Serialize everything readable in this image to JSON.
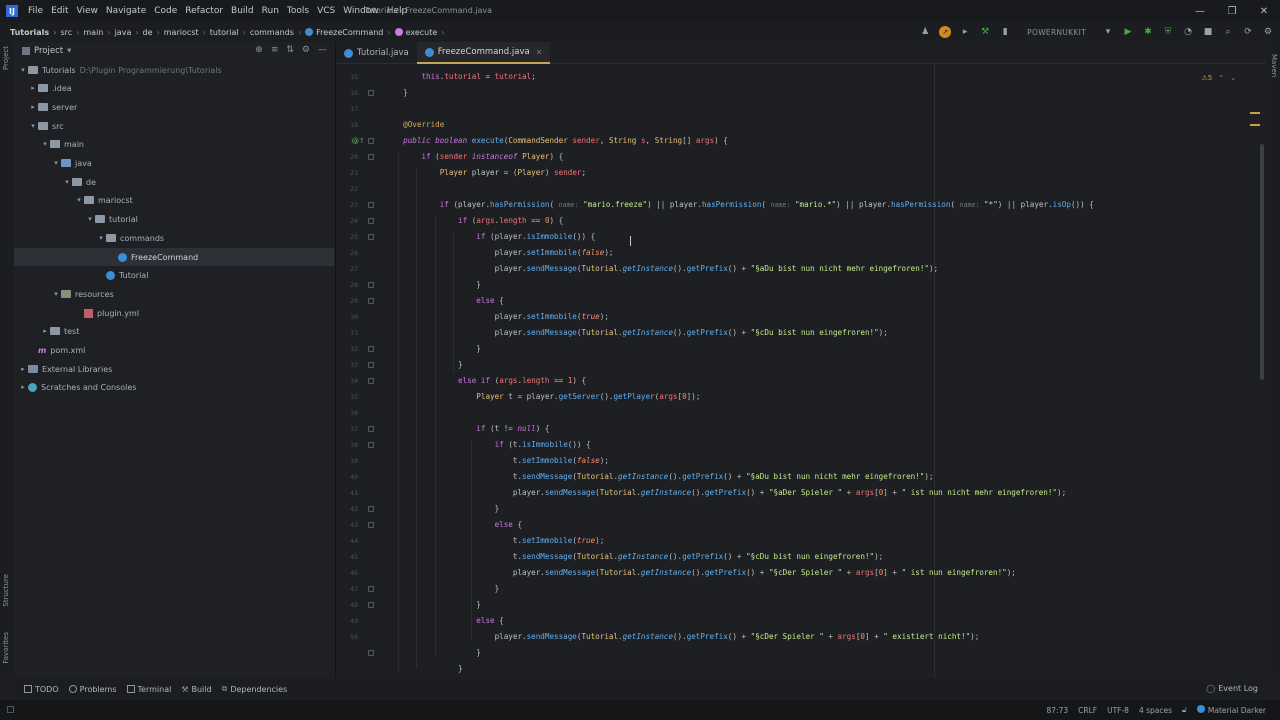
{
  "window": {
    "title": "Tutorials - FreezeCommand.java",
    "menu": [
      "File",
      "Edit",
      "View",
      "Navigate",
      "Code",
      "Refactor",
      "Build",
      "Run",
      "Tools",
      "VCS",
      "Window",
      "Help"
    ],
    "controls": {
      "minimize": "—",
      "maximize": "❐",
      "close": "✕"
    }
  },
  "breadcrumb": [
    "Tutorials",
    "src",
    "main",
    "java",
    "de",
    "mariocst",
    "tutorial",
    "commands",
    "FreezeCommand",
    "execute"
  ],
  "toolbar": {
    "run_config": "POWERNUKKIT"
  },
  "project_panel": {
    "title": "Project",
    "tree": [
      {
        "label": "Tutorials",
        "extra": "D:\\Plugin Programmierung\\Tutorials",
        "arrow": "▾",
        "icon": "folder"
      },
      {
        "label": ".idea",
        "arrow": "▸",
        "icon": "folder"
      },
      {
        "label": "server",
        "arrow": "▸",
        "icon": "folder"
      },
      {
        "label": "src",
        "arrow": "▾",
        "icon": "folder"
      },
      {
        "label": "main",
        "arrow": "▾",
        "icon": "folder"
      },
      {
        "label": "java",
        "arrow": "▾",
        "icon": "src"
      },
      {
        "label": "de",
        "arrow": "▾",
        "icon": "folder"
      },
      {
        "label": "mariocst",
        "arrow": "▾",
        "icon": "folder"
      },
      {
        "label": "tutorial",
        "arrow": "▾",
        "icon": "folder"
      },
      {
        "label": "commands",
        "arrow": "▾",
        "icon": "folder"
      },
      {
        "label": "FreezeCommand",
        "arrow": "",
        "icon": "class"
      },
      {
        "label": "Tutorial",
        "arrow": "",
        "icon": "class"
      },
      {
        "label": "resources",
        "arrow": "▾",
        "icon": "res"
      },
      {
        "label": "plugin.yml",
        "arrow": "",
        "icon": "yml"
      },
      {
        "label": "test",
        "arrow": "▸",
        "icon": "folder"
      },
      {
        "label": "pom.xml",
        "arrow": "",
        "icon": "m"
      },
      {
        "label": "External Libraries",
        "arrow": "▸",
        "icon": "ext"
      },
      {
        "label": "Scratches and Consoles",
        "arrow": "▸",
        "icon": "scratch"
      }
    ]
  },
  "editor": {
    "tabs": [
      {
        "label": "Tutorial.java",
        "active": false
      },
      {
        "label": "FreezeCommand.java",
        "active": true
      }
    ],
    "warnings": "⚠5",
    "line_numbers": [
      "15",
      "16",
      "17",
      "18",
      "19",
      "20",
      "21",
      "22",
      "23",
      "24",
      "25",
      "26",
      "27",
      "28",
      "29",
      "30",
      "31",
      "32",
      "33",
      "34",
      "35",
      "36",
      "37",
      "38",
      "39",
      "40",
      "41",
      "42",
      "43",
      "44",
      "45",
      "46",
      "47",
      "48",
      "49",
      "50"
    ]
  },
  "bottom_tools": [
    "TODO",
    "Problems",
    "Terminal",
    "Build",
    "Dependencies"
  ],
  "event_log": "Event Log",
  "status": {
    "position": "87:73",
    "line_sep": "CRLF",
    "encoding": "UTF-8",
    "indent": "4 spaces",
    "theme": "Material Darker"
  },
  "side_labels": {
    "project": "Project",
    "structure": "Structure",
    "favorites": "Favorites",
    "maven": "Maven"
  },
  "colors": {
    "accent": "#c3a656",
    "keyword": "#c778dd",
    "function": "#61aeee",
    "string": "#c3e88d"
  }
}
